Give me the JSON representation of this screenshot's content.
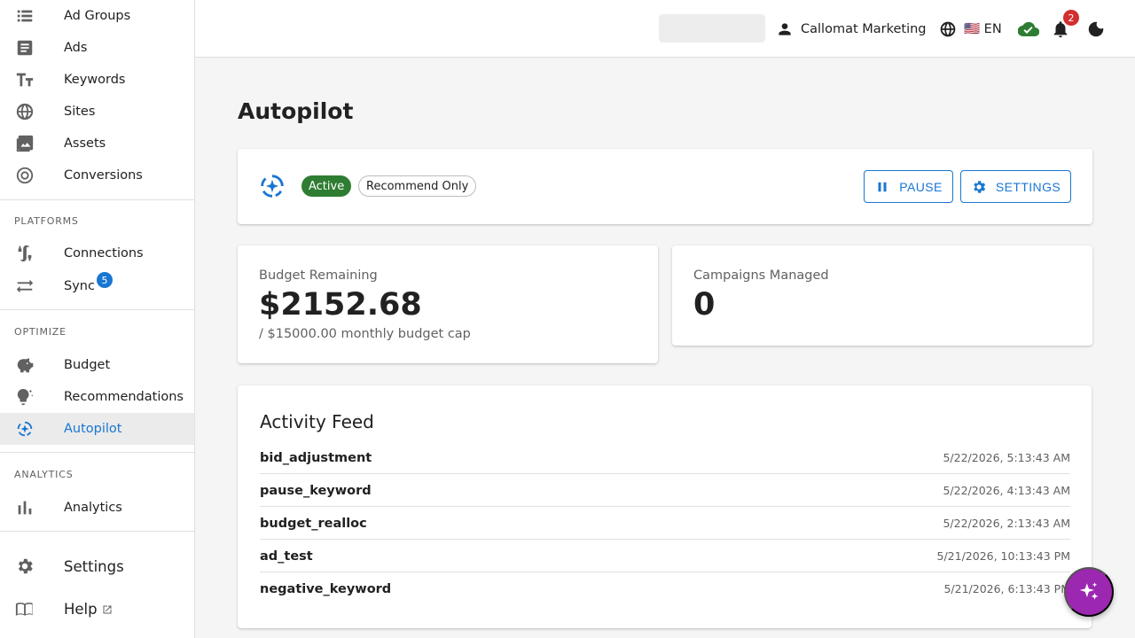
{
  "sidebar": {
    "items_top": [
      {
        "label": "Ad Groups",
        "icon": "list-icon"
      },
      {
        "label": "Ads",
        "icon": "article-icon"
      },
      {
        "label": "Keywords",
        "icon": "text-fields-icon"
      },
      {
        "label": "Sites",
        "icon": "globe-icon"
      },
      {
        "label": "Assets",
        "icon": "image-icon"
      },
      {
        "label": "Conversions",
        "icon": "target-icon"
      }
    ],
    "platforms": {
      "header": "PLATFORMS",
      "connections": "Connections",
      "sync": "Sync",
      "sync_badge": "5"
    },
    "optimize": {
      "header": "OPTIMIZE",
      "budget": "Budget",
      "recommendations": "Recommendations",
      "autopilot": "Autopilot"
    },
    "analytics": {
      "header": "ANALYTICS",
      "analytics": "Analytics"
    },
    "settings": "Settings",
    "help": "Help"
  },
  "topbar": {
    "account": "Callomat Marketing",
    "language": "🇺🇸 EN",
    "notifications_count": "2",
    "icons": [
      "person-icon",
      "globe-icon",
      "cloud-done-icon",
      "bell-icon",
      "dark-mode-icon"
    ]
  },
  "page": {
    "title": "Autopilot"
  },
  "status": {
    "active_chip": "Active",
    "mode_chip": "Recommend Only",
    "pause_label": "PAUSE",
    "settings_label": "SETTINGS"
  },
  "stats": {
    "budget": {
      "label": "Budget Remaining",
      "value": "$2152.68",
      "sub": "/ $15000.00 monthly budget cap"
    },
    "campaigns": {
      "label": "Campaigns Managed",
      "value": "0"
    }
  },
  "feed": {
    "title": "Activity Feed",
    "rows": [
      {
        "action": "bid_adjustment",
        "time": "5/22/2026, 5:13:43 AM"
      },
      {
        "action": "pause_keyword",
        "time": "5/22/2026, 4:13:43 AM"
      },
      {
        "action": "budget_realloc",
        "time": "5/22/2026, 2:13:43 AM"
      },
      {
        "action": "ad_test",
        "time": "5/21/2026, 10:13:43 PM"
      },
      {
        "action": "negative_keyword",
        "time": "5/21/2026, 6:13:43 PM"
      }
    ]
  },
  "colors": {
    "primary": "#1976d2",
    "active_chip": "#2e7d32",
    "notification_badge": "#d32f2f",
    "fab": "#9c27b0"
  }
}
